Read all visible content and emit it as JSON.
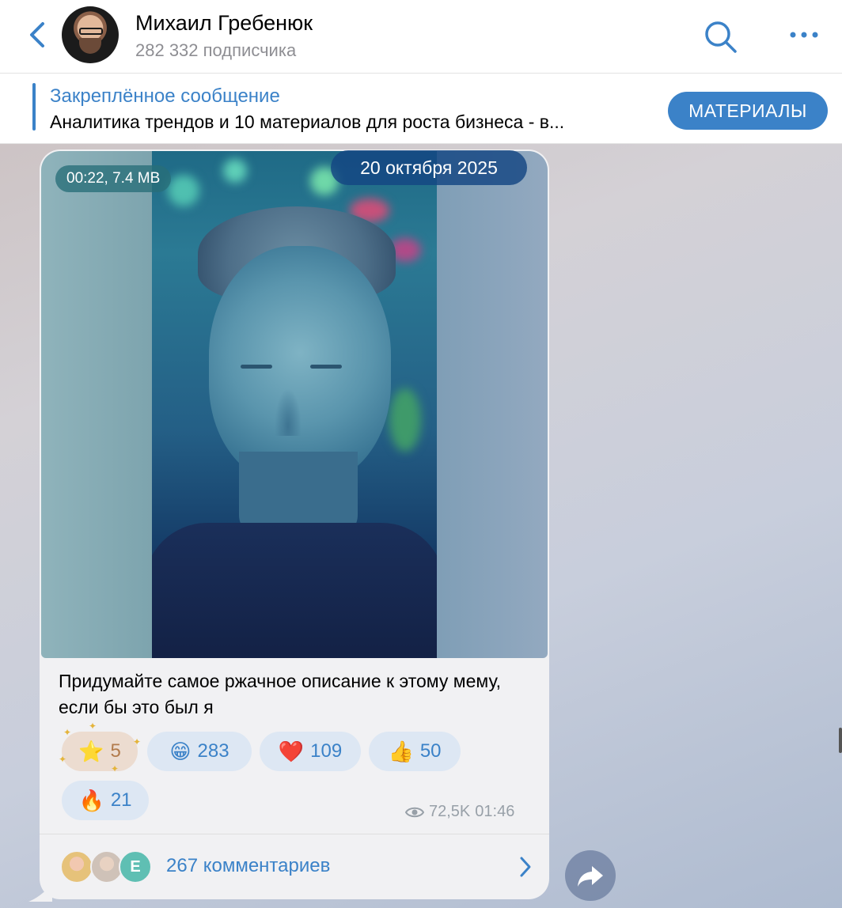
{
  "header": {
    "channel_name": "Михаил Гребенюк",
    "subscribers": "282 332 подписчика",
    "icons": [
      "back-chevron-icon",
      "search-icon",
      "more-icon"
    ]
  },
  "pinned": {
    "title": "Закреплённое сообщение",
    "text": "Аналитика трендов и 10 материалов для роста бизнеса - в...",
    "button_label": "МАТЕРИАЛЫ"
  },
  "message": {
    "media_meta": "00:22, 7.4 MB",
    "date": "20 октября 2025",
    "caption": "Придумайте самое ржачное описание к этому мему, если бы это был я",
    "reactions": [
      {
        "emoji": "⭐",
        "count": "5",
        "kind": "star"
      },
      {
        "emoji": "😁",
        "count": "283"
      },
      {
        "emoji": "❤️",
        "count": "109"
      },
      {
        "emoji": "👍",
        "count": "50"
      },
      {
        "emoji": "🔥",
        "count": "21"
      }
    ],
    "views": "72,5K",
    "time": "01:46",
    "comments": {
      "avatar_letter": "E",
      "label": "267 комментариев"
    }
  },
  "colors": {
    "accent": "#3b82c8",
    "bubble": "#f1f1f3",
    "reaction_bg": "#dde7f3"
  }
}
